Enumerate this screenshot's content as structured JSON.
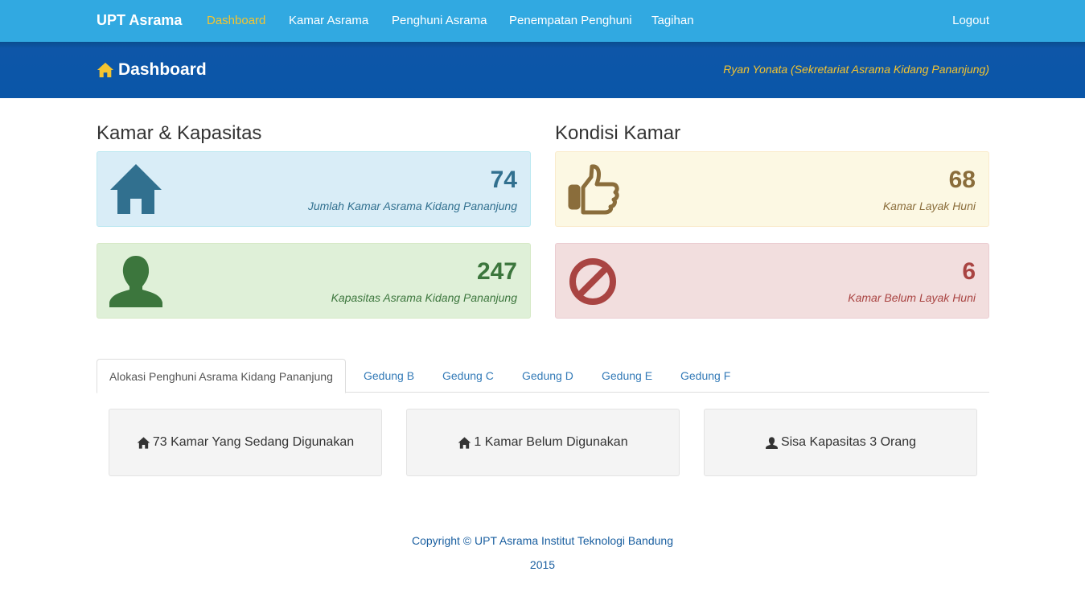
{
  "navbar": {
    "brand": "UPT Asrama",
    "links": [
      {
        "label": "Dashboard",
        "active": true
      },
      {
        "label": "Kamar Asrama",
        "active": false
      },
      {
        "label": "Penghuni Asrama",
        "active": false
      },
      {
        "label": "Penempatan Penghuni",
        "active": false
      },
      {
        "label": "Tagihan",
        "active": false
      }
    ],
    "logout": "Logout"
  },
  "header": {
    "title": "Dashboard",
    "icon": "home-icon",
    "user": "Ryan Yonata (Sekretariat Asrama Kidang Pananjung)"
  },
  "sections": {
    "left_title": "Kamar & Kapasitas",
    "right_title": "Kondisi Kamar"
  },
  "stats": [
    {
      "value": "74",
      "caption": "Jumlah Kamar Asrama Kidang Pananjung",
      "icon": "home-icon",
      "color": "#31708f"
    },
    {
      "value": "68",
      "caption": "Kamar Layak Huni",
      "icon": "thumbs-up-icon",
      "color": "#8a6d3b"
    },
    {
      "value": "247",
      "caption": "Kapasitas Asrama Kidang Pananjung",
      "icon": "user-icon",
      "color": "#3c763d"
    },
    {
      "value": "6",
      "caption": "Kamar Belum Layak Huni",
      "icon": "ban-icon",
      "color": "#a94442"
    }
  ],
  "tabs": [
    {
      "label": "Alokasi Penghuni Asrama Kidang Pananjung",
      "active": true
    },
    {
      "label": "Gedung B",
      "active": false
    },
    {
      "label": "Gedung C",
      "active": false
    },
    {
      "label": "Gedung D",
      "active": false
    },
    {
      "label": "Gedung E",
      "active": false
    },
    {
      "label": "Gedung F",
      "active": false
    }
  ],
  "allocation": [
    {
      "text": "73 Kamar Yang Sedang Digunakan",
      "icon": "home-icon"
    },
    {
      "text": "1 Kamar Belum Digunakan",
      "icon": "home-icon"
    },
    {
      "text": "Sisa Kapasitas 3 Orang",
      "icon": "user-icon"
    }
  ],
  "footer": {
    "copyright": "Copyright © UPT Asrama Institut Teknologi Bandung",
    "year": "2015"
  },
  "colors": {
    "navbar": "#31a9e1",
    "header": "#0a56a8",
    "accent": "#f4c430"
  }
}
